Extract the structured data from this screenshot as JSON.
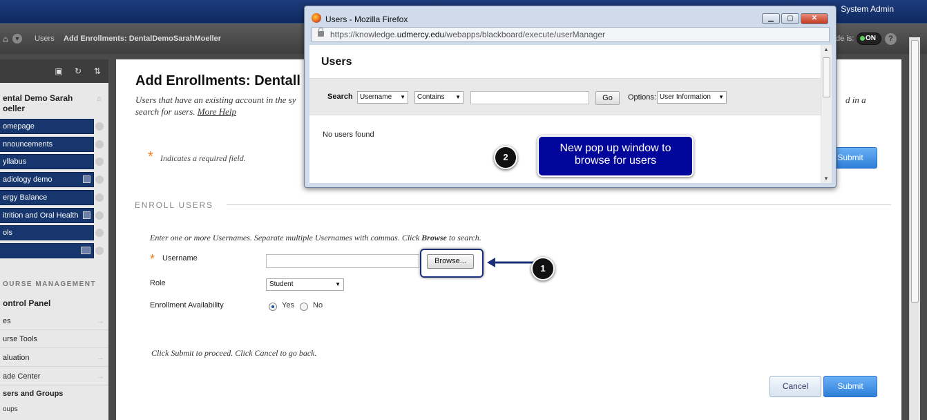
{
  "topbar": {
    "user": "System Admin"
  },
  "breadcrumb": {
    "items": [
      "Users",
      "Add Enrollments: DentalDemoSarahMoeller"
    ],
    "edit_mode_label": "de is:",
    "edit_mode_value": "ON",
    "help": "?"
  },
  "sidebar": {
    "tool_icons": [
      "folder-icon",
      "refresh-icon",
      "sort-icon"
    ],
    "course_title": "ental Demo Sarah oeller",
    "menu_items": [
      {
        "label": "omepage"
      },
      {
        "label": "nnouncements"
      },
      {
        "label": "yllabus"
      },
      {
        "label": "adiology demo"
      },
      {
        "label": "ergy Balance"
      },
      {
        "label": "itrition and Oral Health"
      },
      {
        "label": "ols"
      },
      {
        "label": ""
      }
    ],
    "course_management": "OURSE MANAGEMENT",
    "control_panel": "ontrol Panel",
    "cp_items": [
      {
        "label": "es",
        "arrow": "→"
      },
      {
        "label": "urse Tools",
        "arrow": ""
      },
      {
        "label": "aluation",
        "arrow": "→"
      },
      {
        "label": "ade Center",
        "arrow": "→"
      }
    ],
    "users_groups": "sers and Groups",
    "groups": "oups"
  },
  "main": {
    "title": "Add Enrollments: Dentall",
    "description": "Users that have an existing account in the sy",
    "description_tail": "d in a",
    "description_line2": "search for users.",
    "more_help": "More Help",
    "required_star": "*",
    "required_text": "Indicates a required field.",
    "section_heading": "ENROLL USERS",
    "instructions_pre": "Enter one or more Usernames. Separate multiple Usernames with commas. Click",
    "instructions_bold": "Browse",
    "instructions_post": "to search.",
    "username_label": "Username",
    "username_value": "",
    "browse_label": "Browse...",
    "role_label": "Role",
    "role_value": "Student",
    "availability_label": "Enrollment Availability",
    "yes_label": "Yes",
    "no_label": "No",
    "proceed_text": "Click Submit to proceed. Click Cancel to go back.",
    "submit_label": "Submit",
    "cancel_label": "Cancel"
  },
  "callouts": {
    "step1": "1",
    "step2": "2",
    "step2_text_line1": "New pop up window to",
    "step2_text_line2": "browse for users"
  },
  "popup": {
    "window_title": "Users - Mozilla Firefox",
    "url_prefix": "https://knowledge.",
    "url_domain": "udmercy.edu",
    "url_path": "/webapps/blackboard/execute/userManager",
    "heading": "Users",
    "search_label": "Search",
    "field_select": "Username",
    "operator_select": "Contains",
    "search_value": "",
    "go_label": "Go",
    "options_label": "Options:",
    "options_select": "User Information",
    "no_results": "No users found"
  },
  "colors": {
    "primary_navy": "#17366e",
    "callout_blue": "#03069a",
    "submit_blue": "#2d7fd9",
    "required_orange": "#f07c1c"
  }
}
